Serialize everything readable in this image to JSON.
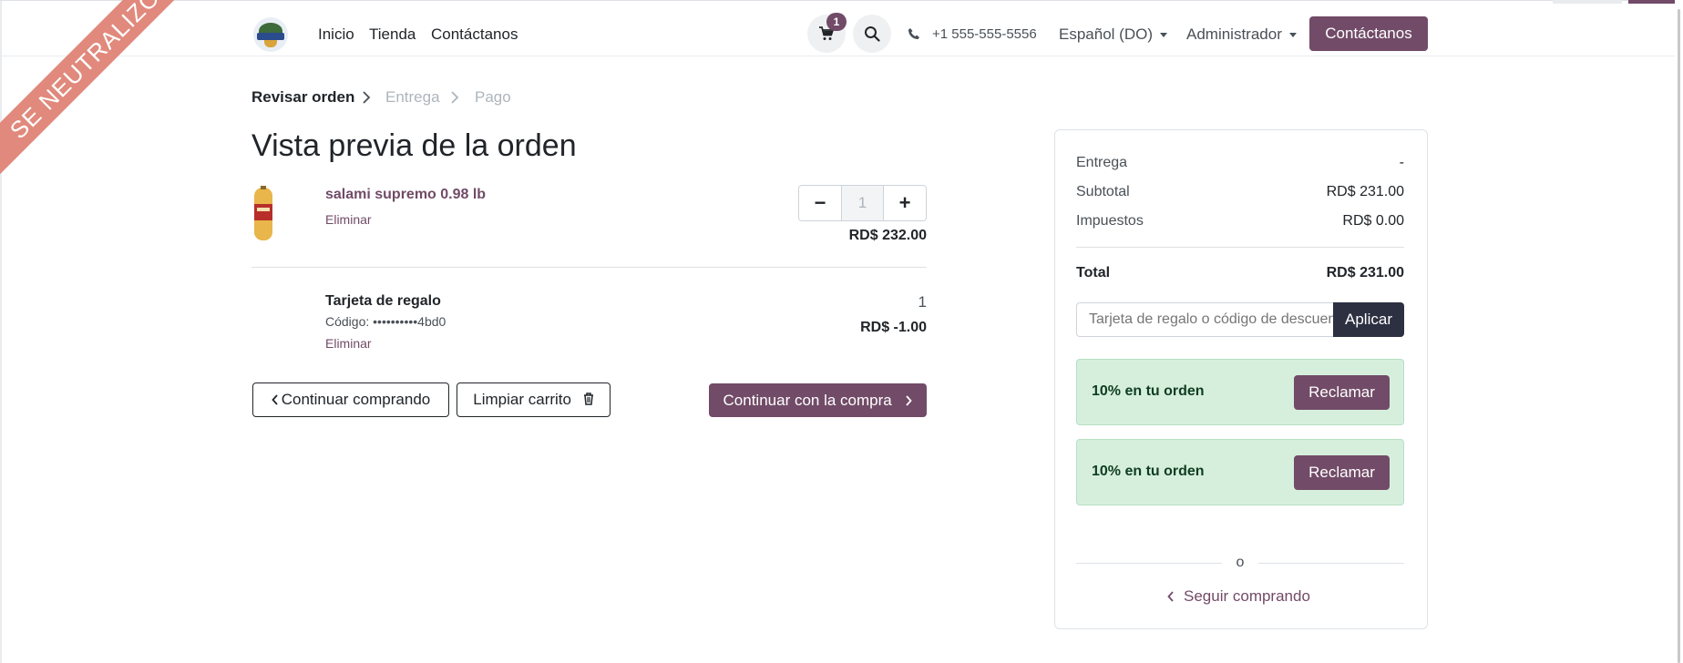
{
  "ribbon": {
    "text": "SE NEUTRALIZÓ"
  },
  "header": {
    "logo_icon": "store-logo",
    "nav": [
      "Inicio",
      "Tienda",
      "Contáctanos"
    ],
    "cart_count": "1",
    "phone": "+1 555-555-5556",
    "language": "Español (DO)",
    "user": "Administrador",
    "contact_button": "Contáctanos"
  },
  "breadcrumb": {
    "steps": [
      "Revisar orden",
      "Entrega",
      "Pago"
    ]
  },
  "page": {
    "title": "Vista previa de la orden"
  },
  "lines": [
    {
      "name": "salami supremo 0.98 lb",
      "remove": "Eliminar",
      "qty": "1",
      "price": "RD$ 232.00"
    },
    {
      "name": "Tarjeta de regalo",
      "code": "Código: ••••••••••4bd0",
      "remove": "Eliminar",
      "qty": "1",
      "price": "RD$ -1.00"
    }
  ],
  "actions": {
    "continue_shopping": "Continuar comprando",
    "clear_cart": "Limpiar carrito",
    "checkout": "Continuar con la compra"
  },
  "summary": {
    "delivery_label": "Entrega",
    "delivery_value": "-",
    "subtotal_label": "Subtotal",
    "subtotal_value": "RD$ 231.00",
    "taxes_label": "Impuestos",
    "taxes_value": "RD$ 0.00",
    "total_label": "Total",
    "total_value": "RD$ 231.00",
    "promo_placeholder": "Tarjeta de regalo o código de descuento",
    "apply": "Aplicar",
    "rewards": [
      {
        "text": "10% en tu orden",
        "button": "Reclamar"
      },
      {
        "text": "10% en tu orden",
        "button": "Reclamar"
      }
    ],
    "or": "o",
    "keep_shopping": "Seguir comprando"
  },
  "colors": {
    "brand": "#714b67",
    "dark_button": "#2c3041",
    "reward_bg": "#d6efdc",
    "ribbon": "#e0897c"
  }
}
